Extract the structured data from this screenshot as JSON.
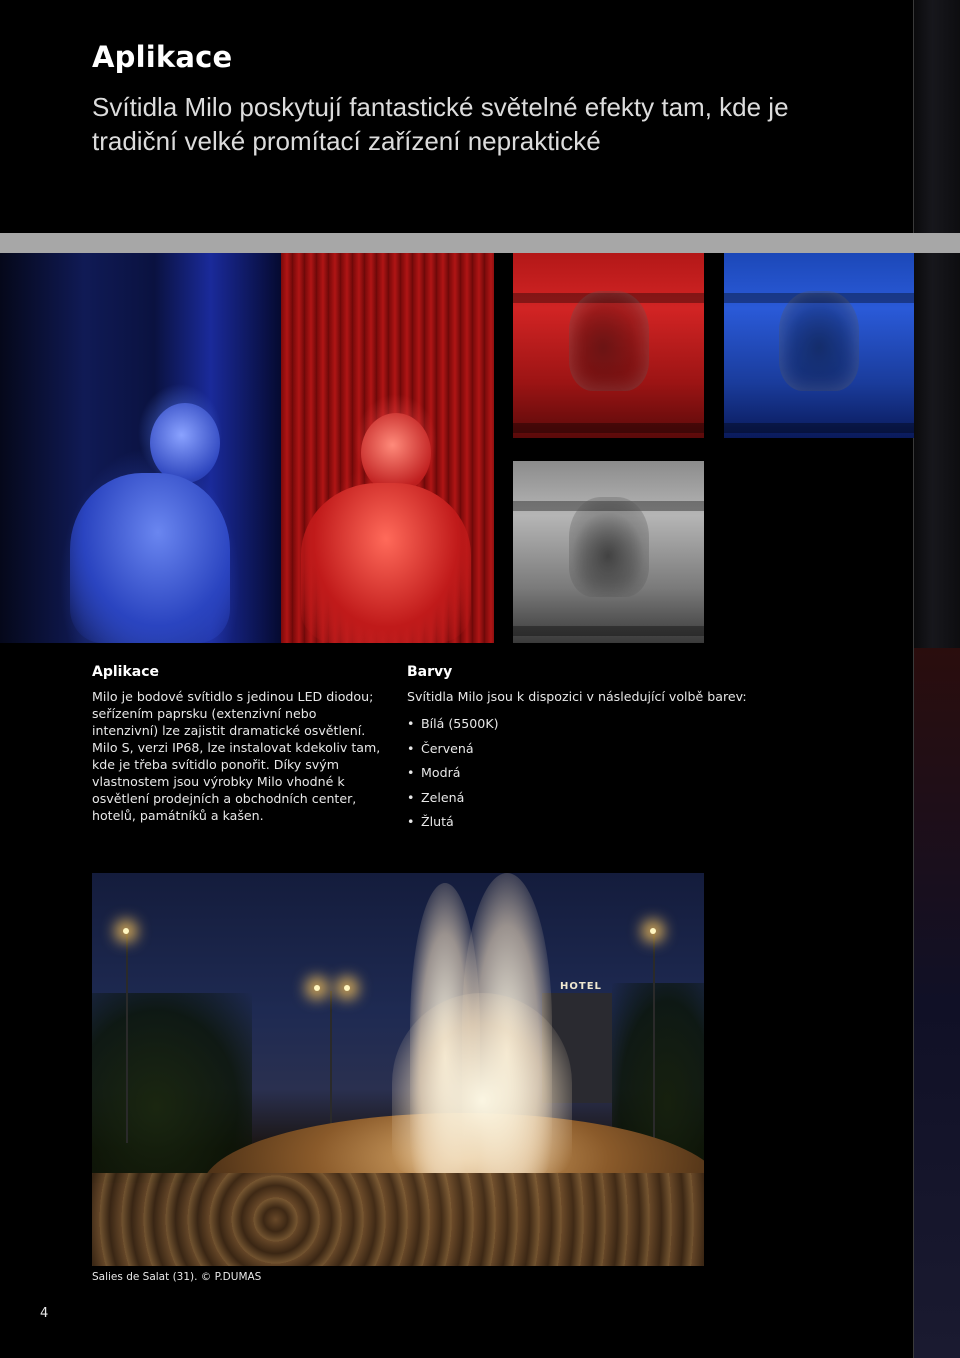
{
  "header": {
    "title": "Aplikace",
    "subtitle": "Svítidla Milo poskytují fantastické světelné efekty tam, kde je tradiční velké promítací zařízení nepraktické"
  },
  "applications": {
    "title": "Aplikace",
    "body": "Milo je bodové svítidlo s jedinou LED diodou; seřízením paprsku (extenzivní nebo intenzivní) lze zajistit dramatické osvětlení. Milo S, verzi IP68, lze instalovat kdekoliv tam, kde je třeba svítidlo ponořit. Díky svým vlastnostem jsou výrobky Milo vhodné k osvětlení prodejních a obchodních center, hotelů, památníků a kašen."
  },
  "colors": {
    "title": "Barvy",
    "intro": "Svítidla Milo jsou k dispozici v následující volbě barev:",
    "items": [
      "Bílá (5500K)",
      "Červená",
      "Modrá",
      "Zelená",
      "Žlutá"
    ]
  },
  "fountain_photo": {
    "sign_text": "HOTEL",
    "caption": "Salies de Salat (31). © P.DUMAS"
  },
  "page_number": "4",
  "palette": {
    "background": "#000000",
    "band": "#a7a7a7",
    "text": "#ffffff"
  }
}
